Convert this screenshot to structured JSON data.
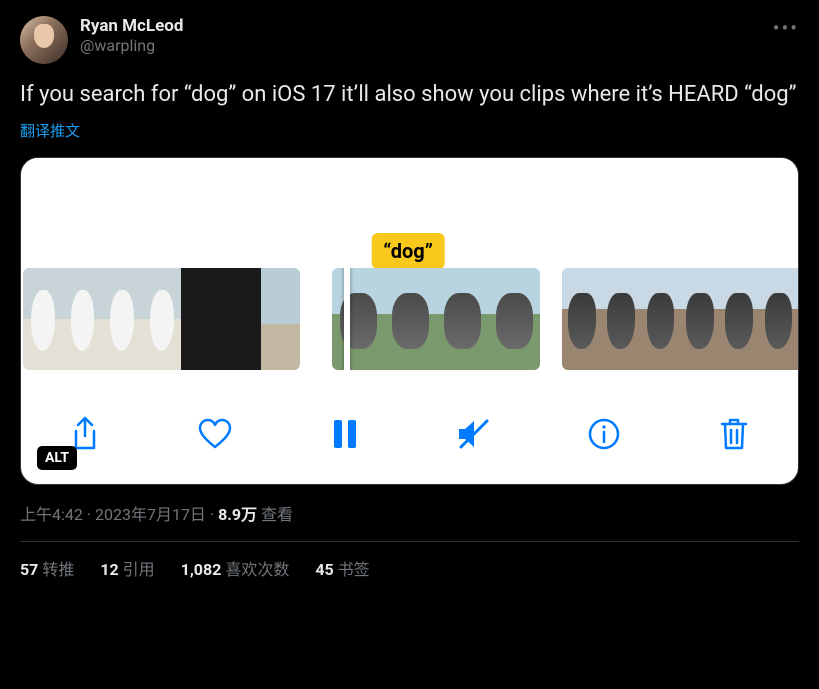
{
  "user": {
    "display_name": "Ryan McLeod",
    "handle": "@warpling"
  },
  "more_label": "•••",
  "content_text": "If you search for “dog” on iOS 17 it’ll also show you clips where it’s HEARD “dog”",
  "translate_label": "翻译推文",
  "media": {
    "search_chip": "“dog”",
    "alt_badge": "ALT",
    "toolbar": {
      "share": "share",
      "like": "like",
      "pause": "pause",
      "mute": "mute",
      "info": "info",
      "delete": "delete"
    }
  },
  "meta": {
    "time": "上午4:42",
    "sep1": " · ",
    "date": "2023年7月17日",
    "sep2": " · ",
    "views_num": "8.9万",
    "views_label": " 查看"
  },
  "stats": {
    "retweets_num": "57",
    "retweets_label": " 转推",
    "quotes_num": "12",
    "quotes_label": " 引用",
    "likes_num": "1,082",
    "likes_label": " 喜欢次数",
    "bookmarks_num": "45",
    "bookmarks_label": " 书签"
  }
}
